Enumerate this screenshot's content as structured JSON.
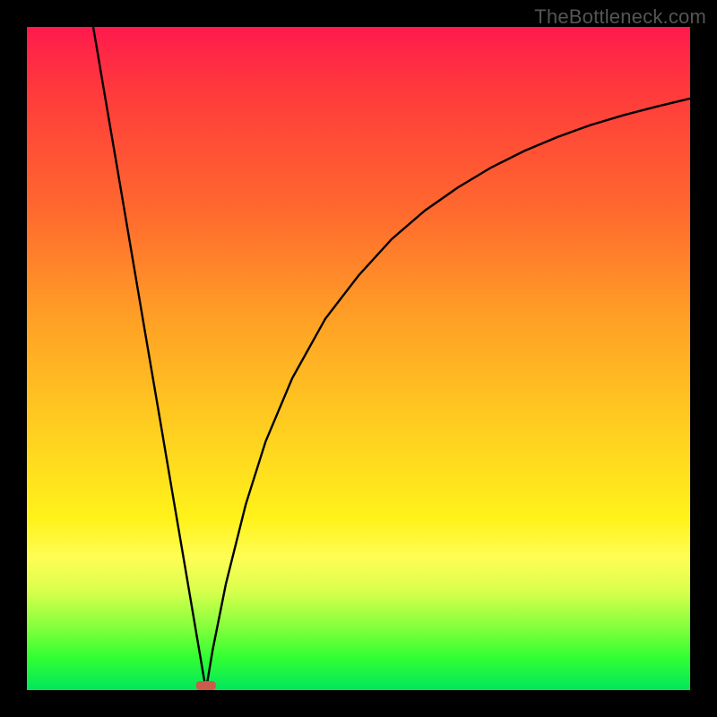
{
  "watermark": "TheBottleneck.com",
  "chart_data": {
    "type": "line",
    "title": "",
    "xlabel": "",
    "ylabel": "",
    "xlim": [
      0,
      100
    ],
    "ylim": [
      0,
      100
    ],
    "background": "vertical gradient red→orange→yellow→green (top→bottom)",
    "marker": {
      "x": 27,
      "y": 0,
      "color": "#cc5b4d"
    },
    "series": [
      {
        "name": "left-branch",
        "x": [
          10,
          12,
          14,
          16,
          18,
          20,
          22,
          24,
          25,
          26,
          27
        ],
        "y": [
          100,
          88.2,
          76.5,
          64.7,
          52.9,
          41.2,
          29.4,
          17.7,
          11.8,
          5.9,
          0
        ]
      },
      {
        "name": "right-branch",
        "x": [
          27,
          28,
          30,
          33,
          36,
          40,
          45,
          50,
          55,
          60,
          65,
          70,
          75,
          80,
          85,
          90,
          95,
          100
        ],
        "y": [
          0,
          6,
          16,
          28,
          37.5,
          47,
          56,
          62.5,
          68,
          72.3,
          75.8,
          78.8,
          81.3,
          83.4,
          85.2,
          86.7,
          88,
          89.2
        ]
      }
    ]
  }
}
